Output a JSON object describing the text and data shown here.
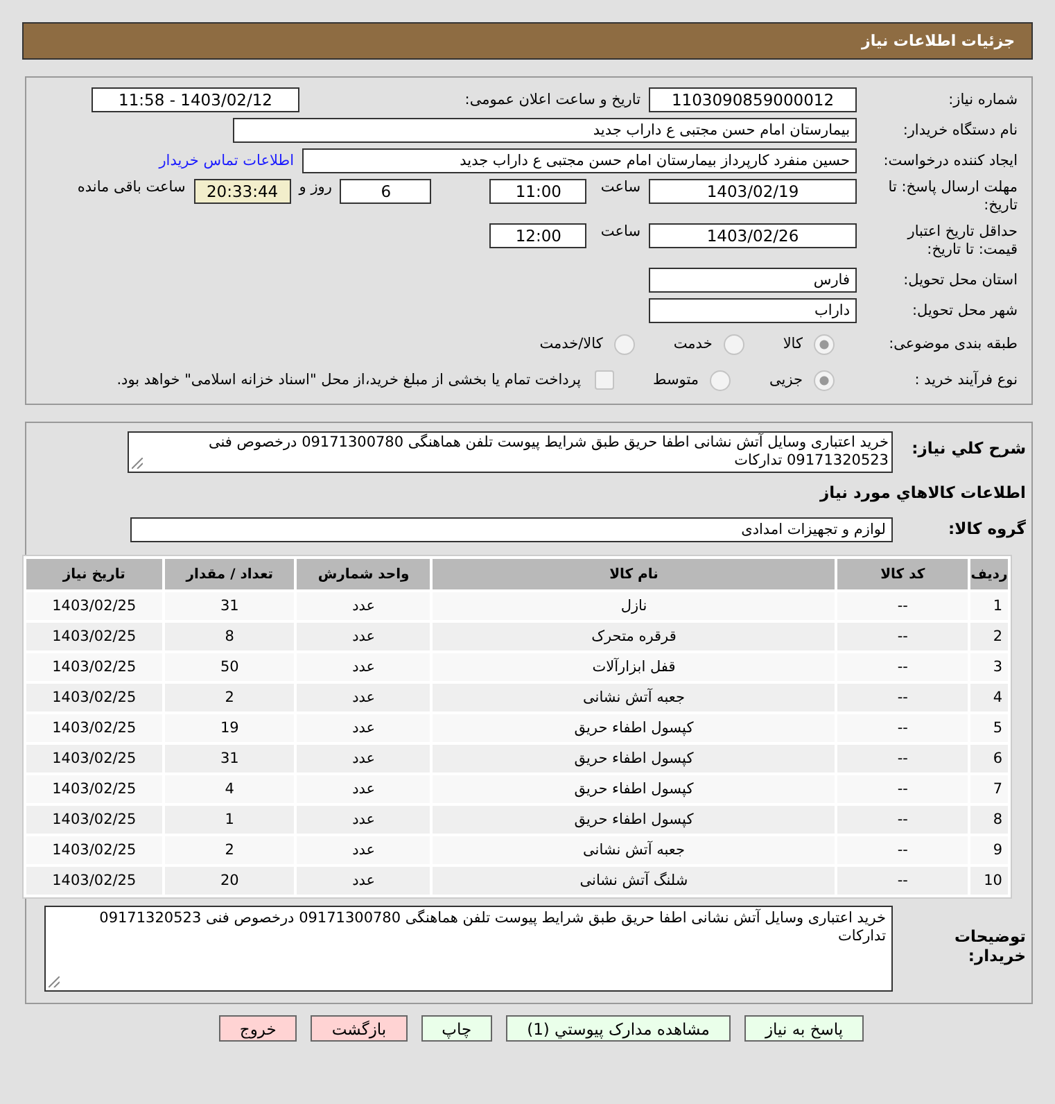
{
  "header": {
    "title": "جزئیات اطلاعات نیاز"
  },
  "need_number": {
    "label": "شماره نیاز:",
    "value": "1103090859000012"
  },
  "announce": {
    "label": "تاریخ و ساعت اعلان عمومی:",
    "value": "1403/02/12 - 11:58"
  },
  "buyer": {
    "label": "نام دستگاه خریدار:",
    "value": "بیمارستان امام حسن مجتبی  ع  داراب جدید"
  },
  "creator": {
    "label": "ایجاد کننده درخواست:",
    "value": "حسین  منفرد کارپرداز بیمارستان امام حسن مجتبی  ع  داراب جدید",
    "link": "اطلاعات تماس خریدار"
  },
  "deadline": {
    "label": "مهلت ارسال پاسخ: تا تاریخ:",
    "date": "1403/02/19",
    "time_label": "ساعت",
    "time": "11:00",
    "days": "6",
    "days_label": "روز و",
    "remaining": "20:33:44",
    "remaining_label": "ساعت باقی مانده"
  },
  "validity": {
    "label": "حداقل تاریخ اعتبار قیمت: تا تاریخ:",
    "date": "1403/02/26",
    "time_label": "ساعت",
    "time": "12:00"
  },
  "province": {
    "label": "استان محل تحویل:",
    "value": "فارس"
  },
  "city": {
    "label": "شهر محل تحویل:",
    "value": "داراب"
  },
  "category": {
    "label": "طبقه بندی موضوعی:",
    "options": [
      {
        "label": "کالا",
        "selected": true
      },
      {
        "label": "خدمت",
        "selected": false
      },
      {
        "label": "کالا/خدمت",
        "selected": false
      }
    ]
  },
  "process": {
    "label": "نوع فرآیند خرید :",
    "options": [
      {
        "label": "جزیی",
        "selected": true
      },
      {
        "label": "متوسط",
        "selected": false
      }
    ],
    "treasury": {
      "label": "پرداخت تمام یا بخشی از مبلغ خرید،از محل \"اسناد خزانه اسلامی\" خواهد بود.",
      "checked": false
    }
  },
  "summary": {
    "label": "شرح کلي نياز:",
    "value": "خرید اعتباری وسایل آتش نشانی اطفا حریق طبق شرایط پیوست تلفن هماهنگی 09171300780 درخصوص فنی 09171320523 تدارکات"
  },
  "goods_heading": "اطلاعات کالاهاي مورد نياز",
  "goods_group": {
    "label": "گروه کالا:",
    "value": "لوازم و تجهیزات امدادی"
  },
  "table": {
    "columns": [
      "ردیف",
      "کد کالا",
      "نام کالا",
      "واحد شمارش",
      "تعداد / مقدار",
      "تاریخ نیاز"
    ],
    "rows": [
      [
        "1",
        "--",
        "نازل",
        "عدد",
        "31",
        "1403/02/25"
      ],
      [
        "2",
        "--",
        "قرقره متحرک",
        "عدد",
        "8",
        "1403/02/25"
      ],
      [
        "3",
        "--",
        "قفل ابزارآلات",
        "عدد",
        "50",
        "1403/02/25"
      ],
      [
        "4",
        "--",
        "جعبه آتش نشانی",
        "عدد",
        "2",
        "1403/02/25"
      ],
      [
        "5",
        "--",
        "کپسول اطفاء حریق",
        "عدد",
        "19",
        "1403/02/25"
      ],
      [
        "6",
        "--",
        "کپسول اطفاء حریق",
        "عدد",
        "31",
        "1403/02/25"
      ],
      [
        "7",
        "--",
        "کپسول اطفاء حریق",
        "عدد",
        "4",
        "1403/02/25"
      ],
      [
        "8",
        "--",
        "کپسول اطفاء حریق",
        "عدد",
        "1",
        "1403/02/25"
      ],
      [
        "9",
        "--",
        "جعبه آتش نشانی",
        "عدد",
        "2",
        "1403/02/25"
      ],
      [
        "10",
        "--",
        "شلنگ آتش نشانی",
        "عدد",
        "20",
        "1403/02/25"
      ]
    ]
  },
  "buyer_notes": {
    "label": "توضیحات خریدار:",
    "value": "خرید اعتباری وسایل آتش نشانی اطفا حریق طبق شرایط پیوست تلفن هماهنگی 09171300780 درخصوص فنی 09171320523 تدارکات"
  },
  "buttons": [
    {
      "label": "پاسخ به نیاز",
      "kind": "action"
    },
    {
      "label": "مشاهده مدارک پیوستي (1)",
      "kind": "action"
    },
    {
      "label": "چاپ",
      "kind": "action"
    },
    {
      "label": "بازگشت",
      "kind": "exit"
    },
    {
      "label": "خروج",
      "kind": "exit"
    }
  ]
}
